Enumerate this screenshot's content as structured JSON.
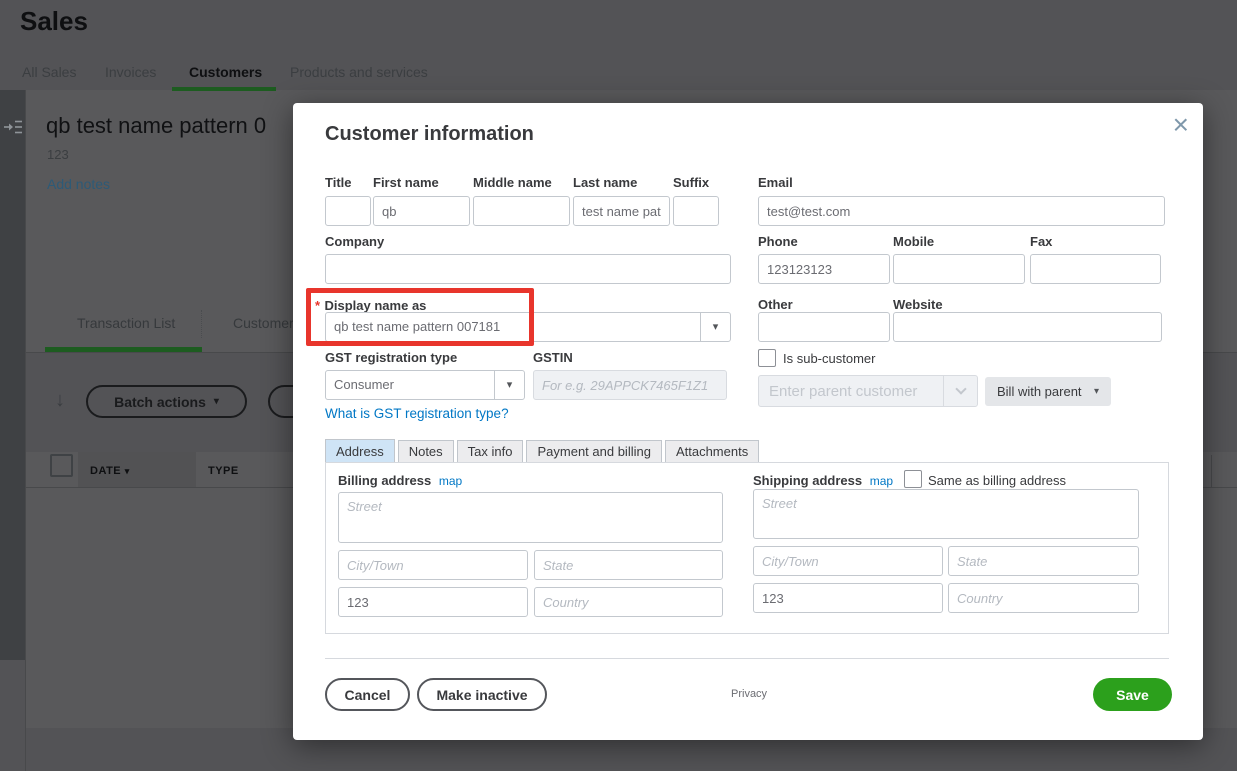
{
  "colors": {
    "qb_green": "#2ca01c",
    "link_blue": "#0077c5",
    "annotation_red": "#e8352c",
    "active_tab_blue": "#cfe4f6"
  },
  "icons": {
    "caret_down": "▾",
    "close": "×",
    "sort_arrow": "↓",
    "required_mark": "*"
  },
  "page": {
    "title": "Sales",
    "nav_tabs": [
      {
        "label": "All Sales"
      },
      {
        "label": "Invoices"
      },
      {
        "label": "Customers"
      },
      {
        "label": "Products and services"
      }
    ],
    "customer_header": {
      "name": "qb test name pattern 0",
      "subtitle": "123",
      "add_notes_link": "Add notes"
    },
    "detail_tabs": [
      {
        "label": "Transaction List"
      },
      {
        "label": "Customer"
      }
    ],
    "toolbar": {
      "batch_actions_label": "Batch actions"
    },
    "table": {
      "headers": [
        {
          "label": "DATE"
        },
        {
          "label": "TYPE"
        }
      ]
    }
  },
  "modal": {
    "title": "Customer information",
    "fields": {
      "title": {
        "label": "Title",
        "value": ""
      },
      "first_name": {
        "label": "First name",
        "value": "qb"
      },
      "middle_name": {
        "label": "Middle name",
        "value": ""
      },
      "last_name": {
        "label": "Last name",
        "value": "test name pat"
      },
      "suffix": {
        "label": "Suffix",
        "value": ""
      },
      "email": {
        "label": "Email",
        "value": "test@test.com"
      },
      "company": {
        "label": "Company",
        "value": ""
      },
      "phone": {
        "label": "Phone",
        "value": "123123123"
      },
      "mobile": {
        "label": "Mobile",
        "value": ""
      },
      "fax": {
        "label": "Fax",
        "value": ""
      },
      "display_name": {
        "label": "Display name as",
        "value": "qb test name pattern 007181"
      },
      "other": {
        "label": "Other",
        "value": ""
      },
      "website": {
        "label": "Website",
        "value": ""
      },
      "gst_type": {
        "label": "GST registration type",
        "value": "Consumer"
      },
      "gstin": {
        "label": "GSTIN",
        "placeholder": "For e.g. 29APPCK7465F1Z1"
      },
      "is_sub_customer": {
        "label": "Is sub-customer"
      },
      "parent_customer": {
        "placeholder": "Enter parent customer"
      },
      "bill_with_parent": {
        "value": "Bill with parent"
      }
    },
    "gst_help_link": "What is GST registration type?",
    "tabs": [
      "Address",
      "Notes",
      "Tax info",
      "Payment and billing",
      "Attachments"
    ],
    "billing": {
      "label": "Billing address",
      "map_link": "map",
      "street_placeholder": "Street",
      "city_placeholder": "City/Town",
      "state_placeholder": "State",
      "postal_value": "123",
      "country_placeholder": "Country"
    },
    "shipping": {
      "label": "Shipping address",
      "map_link": "map",
      "same_as_billing_label": "Same as billing address",
      "street_placeholder": "Street",
      "city_placeholder": "City/Town",
      "state_placeholder": "State",
      "postal_value": "123",
      "country_placeholder": "Country"
    },
    "footer": {
      "cancel": "Cancel",
      "make_inactive": "Make inactive",
      "privacy": "Privacy",
      "save": "Save"
    }
  }
}
